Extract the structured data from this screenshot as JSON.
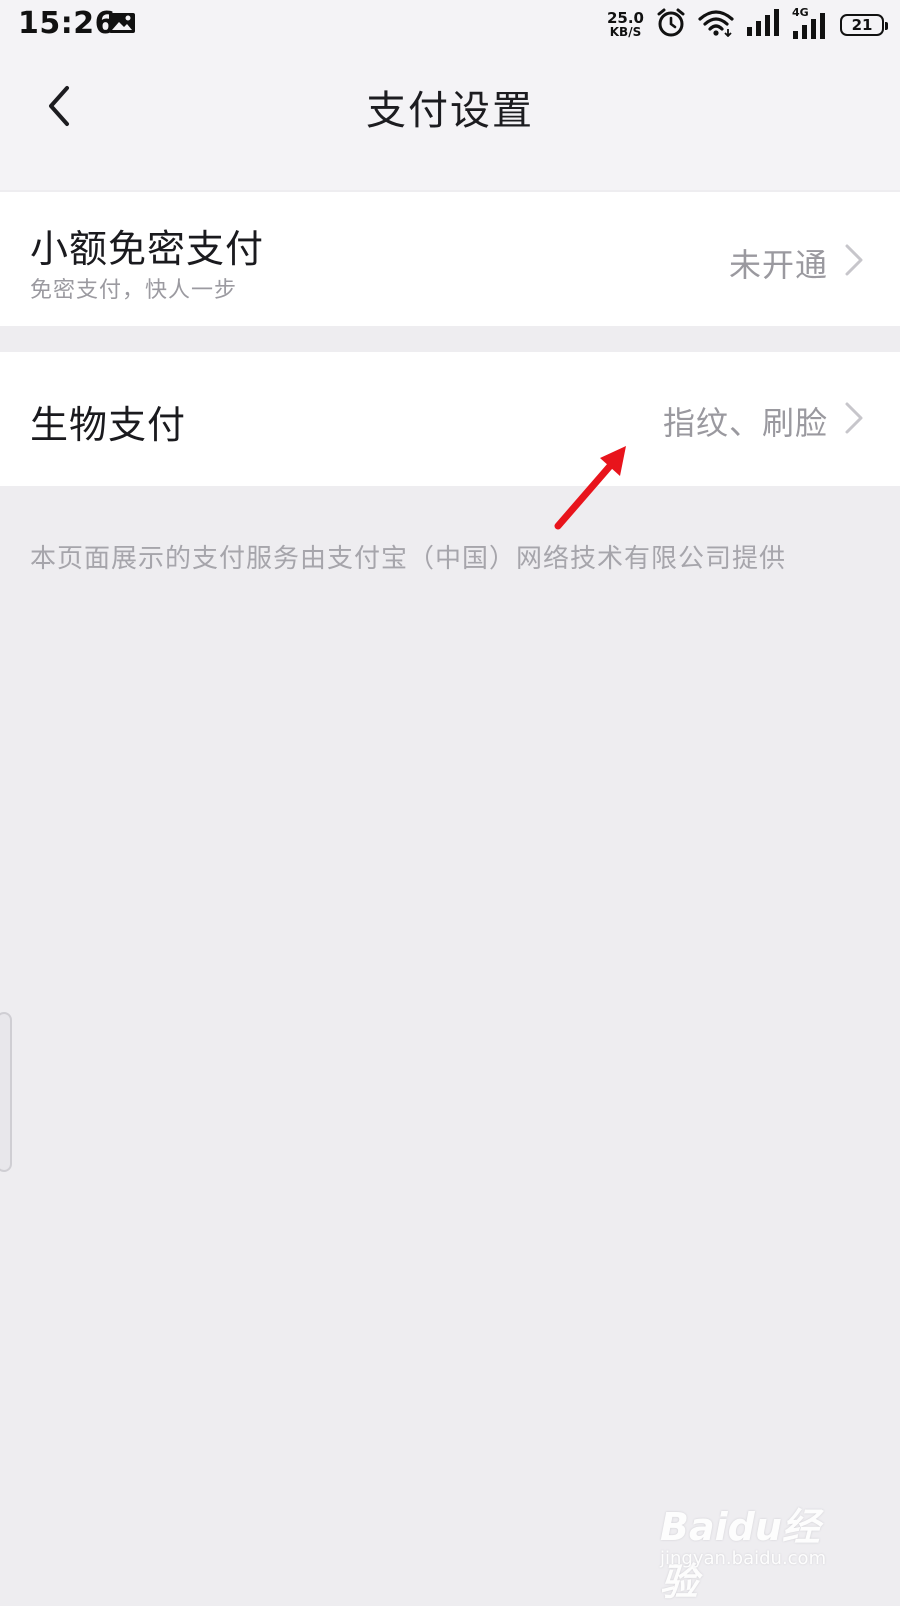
{
  "status_bar": {
    "time": "15:26",
    "net_speed_value": "25.0",
    "net_speed_unit": "KB/S",
    "network_label": "4G",
    "battery": "21"
  },
  "header": {
    "title": "支付设置"
  },
  "rows": [
    {
      "title": "小额免密支付",
      "subtitle": "免密支付，快人一步",
      "value": "未开通"
    },
    {
      "title": "生物支付",
      "value": "指纹、刷脸"
    }
  ],
  "footer_note": "本页面展示的支付服务由支付宝（中国）网络技术有限公司提供",
  "watermark": {
    "logo": "Baidu经验",
    "url": "jingyan.baidu.com"
  },
  "colors": {
    "background": "#EEEDF0",
    "row_background": "#FFFFFF",
    "secondary_text": "#9A999F",
    "annotation_arrow": "#E8141C"
  }
}
